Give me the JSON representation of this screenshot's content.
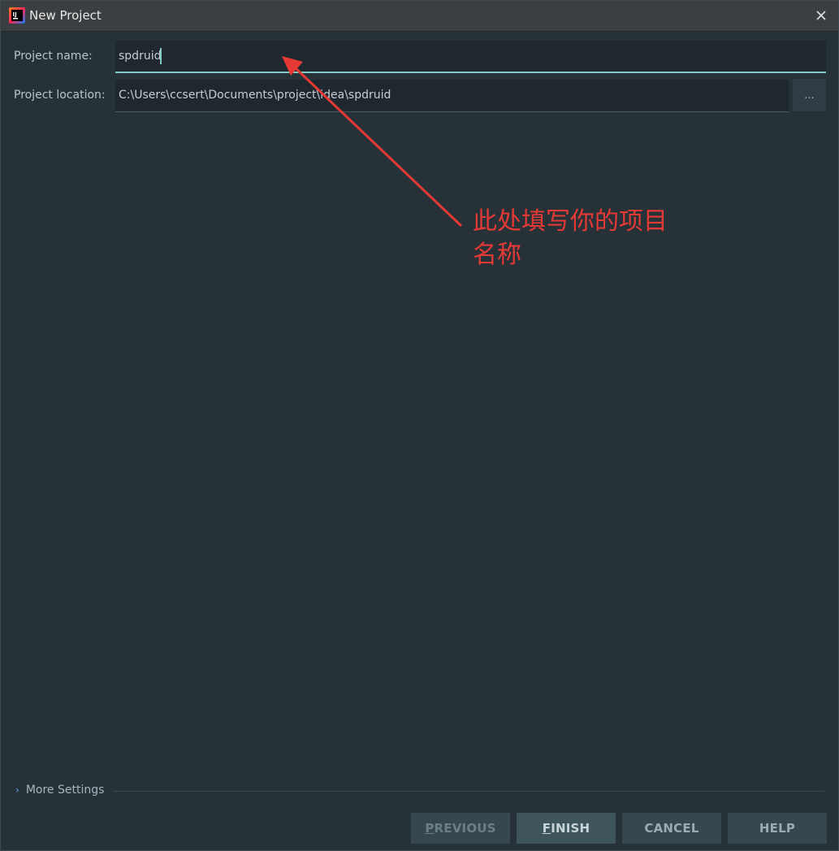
{
  "window": {
    "title": "New Project",
    "icon": "intellij-idea-icon",
    "close_icon": "close-icon"
  },
  "form": {
    "name_label": "Project name:",
    "name_value": "spdruid",
    "location_label": "Project location:",
    "location_value": "C:\\Users\\ccsert\\Documents\\project\\idea\\spdruid",
    "browse_label": "..."
  },
  "more_settings": {
    "label": "More Settings",
    "icon": "chevron-right-icon"
  },
  "buttons": {
    "previous": "PREVIOUS",
    "finish": "FINISH",
    "cancel": "CANCEL",
    "help": "HELP"
  },
  "annotation": {
    "text": "此处填写你的项目名称",
    "color": "#e53935"
  },
  "colors": {
    "accent": "#80cbc4",
    "background": "#263238"
  }
}
